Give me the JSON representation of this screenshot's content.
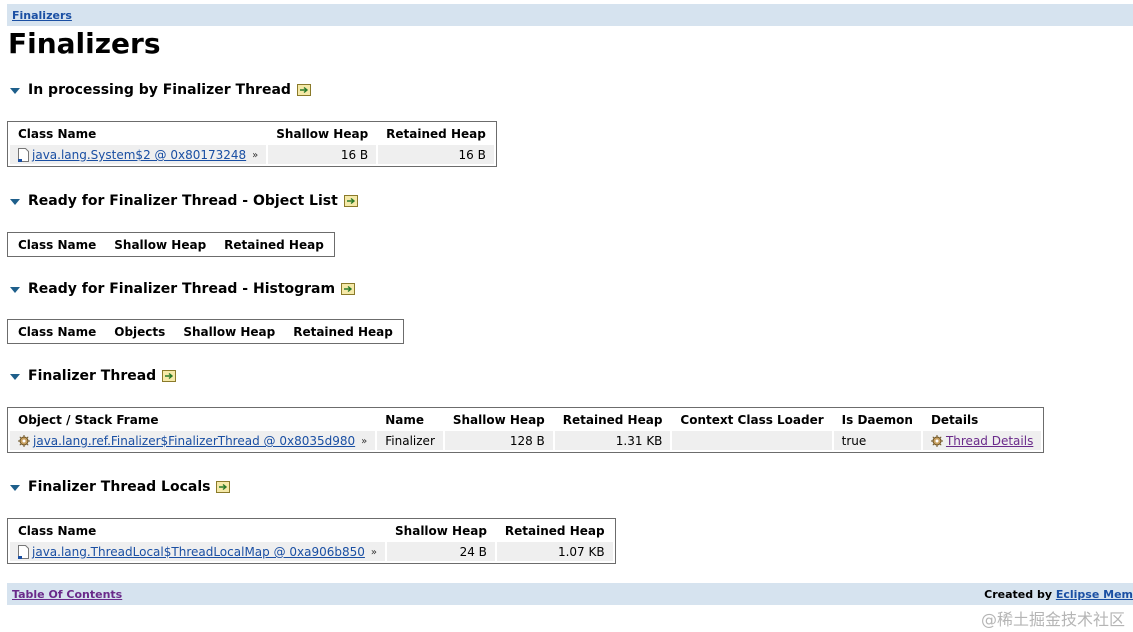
{
  "breadcrumb": {
    "label": "Finalizers"
  },
  "page_title": "Finalizers",
  "sections": [
    {
      "title": "In processing by Finalizer Thread",
      "columns": [
        "Class Name",
        "Shallow Heap",
        "Retained Heap"
      ],
      "rows": [
        {
          "object": "java.lang.System$2 @ 0x80173248",
          "shallow": "16 B",
          "retained": "16 B"
        }
      ]
    },
    {
      "title": "Ready for Finalizer Thread - Object List",
      "columns": [
        "Class Name",
        "Shallow Heap",
        "Retained Heap"
      ]
    },
    {
      "title": "Ready for Finalizer Thread - Histogram",
      "columns": [
        "Class Name",
        "Objects",
        "Shallow Heap",
        "Retained Heap"
      ]
    },
    {
      "title": "Finalizer Thread",
      "columns": [
        "Object / Stack Frame",
        "Name",
        "Shallow Heap",
        "Retained Heap",
        "Context Class Loader",
        "Is Daemon",
        "Details"
      ],
      "rows": [
        {
          "object": "java.lang.ref.Finalizer$FinalizerThread @ 0x8035d980",
          "name": "Finalizer",
          "shallow": "128 B",
          "retained": "1.31 KB",
          "loader": "",
          "daemon": "true",
          "details": "Thread Details"
        }
      ]
    },
    {
      "title": "Finalizer Thread Locals",
      "columns": [
        "Class Name",
        "Shallow Heap",
        "Retained Heap"
      ],
      "rows": [
        {
          "object": "java.lang.ThreadLocal$ThreadLocalMap @ 0xa906b850",
          "shallow": "24 B",
          "retained": "1.07 KB"
        }
      ]
    }
  ],
  "footer": {
    "toc": "Table Of Contents",
    "created_by": "Created by",
    "created_link": "Eclipse Mem"
  },
  "watermark": "@稀土掘金技术社区",
  "icons": {
    "expand": "triangle-down-icon",
    "export": "export-icon",
    "object": "file-icon",
    "thread": "gear-icon"
  },
  "colors": {
    "bar": "#d6e3ef",
    "link": "#1a4fa3",
    "visited_link": "#6a2a8a",
    "triangle": "#1e5f8b"
  }
}
